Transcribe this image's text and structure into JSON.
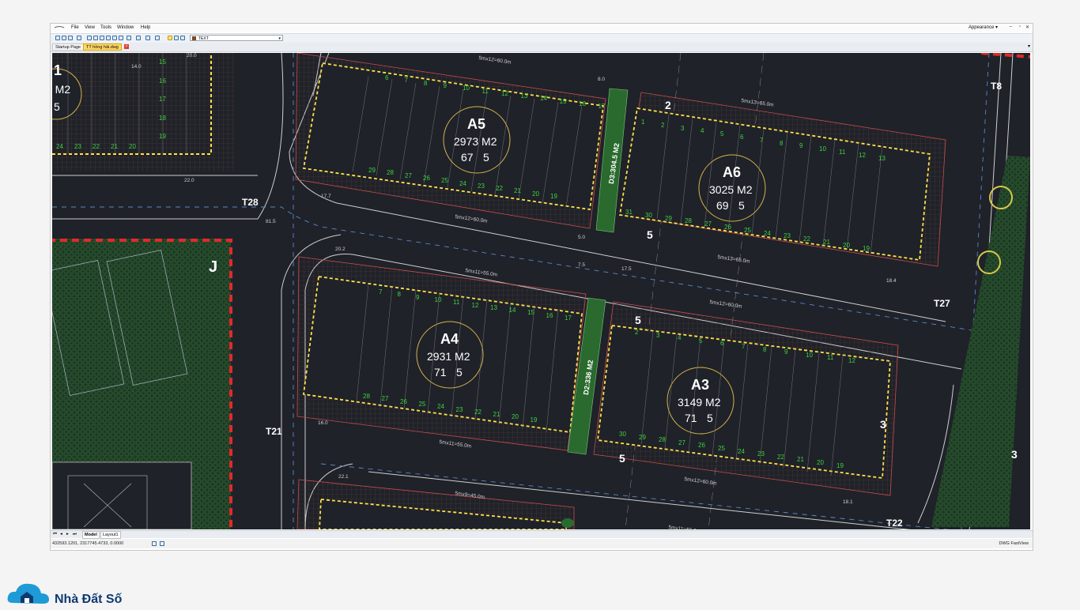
{
  "menubar": {
    "file": "File",
    "view": "View",
    "tools": "Tools",
    "window": "Window",
    "help": "Help",
    "appearance": "Appearance ▾"
  },
  "toolbar": {
    "layer_combo_value": "TEXT"
  },
  "tabs": {
    "startup": "Startup Page",
    "drawing": "TT hồng hải.dwg"
  },
  "bottom_tabs": {
    "model": "Model",
    "layout": "Layout1"
  },
  "status": {
    "coords": "432593.1201, 2317745.4733, 0.0000",
    "brand": "DWG FastView"
  },
  "watermark": {
    "text": "Nhà Đất Số"
  },
  "drawing": {
    "blocks": {
      "a5": {
        "name": "A5",
        "area": "2973 M2",
        "count": "67",
        "floors": "5"
      },
      "a6": {
        "name": "A6",
        "area": "3025 M2",
        "count": "69",
        "floors": "5"
      },
      "a4": {
        "name": "A4",
        "area": "2931 M2",
        "count": "71",
        "floors": "5"
      },
      "a3": {
        "name": "A3",
        "area": "3149 M2",
        "count": "71",
        "floors": "5"
      },
      "left": {
        "area": "5 M2",
        "floors": "5"
      }
    },
    "medians": {
      "d3": "D3:304.5 M2",
      "d2": "D2:336 M2"
    },
    "dims": {
      "a5_top": "5mx12=60.0m",
      "a5_bottom": "5mx12=60.0m",
      "a6_top": "5mx13=65.0m",
      "a6_bottom": "5mx13=65.0m",
      "a4_top": "5mx11=55.0m",
      "a4_bottom": "5mx11=55.0m",
      "a3_top": "5mx12=60.0m",
      "a3_bottom": "5mx12=60.0m",
      "bot_top": "5mx9=45.0m",
      "bot_bottom": "5mx11=55.0m"
    },
    "road_labels": {
      "t28": "T28",
      "t21": "T21",
      "t8": "T8",
      "t27": "T27",
      "t22": "T22",
      "j": "J",
      "lbl_1": "1"
    },
    "sections": {
      "s2": "2",
      "s5a": "5",
      "s5b": "5",
      "s5c": "5",
      "s3a": "3",
      "s3b": "3"
    },
    "measures": {
      "m20_0": "20.0",
      "m22_0": "22.0",
      "m17_7": "17.7",
      "m20_2": "20.2",
      "m18_4": "18.4",
      "m16_0": "16.0",
      "m18_1": "18.1",
      "m22_1": "22.1",
      "m8_0": "8.0",
      "m5_0": "5.0",
      "m7_5": "7.5",
      "m17_5": "17.5",
      "m14_0": "14.0",
      "m81_5": "81.5"
    },
    "lot_numbers": {
      "a5_top": [
        "6",
        "7",
        "8",
        "9",
        "10",
        "11",
        "12",
        "13",
        "14",
        "15",
        "16",
        "17"
      ],
      "a5_bottom": [
        "29",
        "28",
        "27",
        "26",
        "25",
        "24",
        "23",
        "22",
        "21",
        "20",
        "19"
      ],
      "a6_top": [
        "1",
        "2",
        "3",
        "4",
        "5",
        "6",
        "7",
        "8",
        "9",
        "10",
        "11",
        "12",
        "13"
      ],
      "a6_bottom": [
        "31",
        "30",
        "29",
        "28",
        "27",
        "26",
        "25",
        "24",
        "23",
        "22",
        "21",
        "20",
        "19"
      ],
      "a4_top": [
        "7",
        "8",
        "9",
        "10",
        "11",
        "12",
        "13",
        "14",
        "15",
        "16",
        "17"
      ],
      "a4_bottom": [
        "28",
        "27",
        "26",
        "25",
        "24",
        "23",
        "22",
        "21",
        "20",
        "19"
      ],
      "a3_top": [
        "2",
        "3",
        "4",
        "5",
        "6",
        "7",
        "8",
        "9",
        "10",
        "11",
        "12"
      ],
      "a3_bottom": [
        "30",
        "29",
        "28",
        "27",
        "26",
        "25",
        "24",
        "23",
        "22",
        "21",
        "20",
        "19"
      ],
      "left_col": [
        "15",
        "16",
        "17",
        "18",
        "19"
      ],
      "left_bottom": [
        "24",
        "23",
        "22",
        "21",
        "20"
      ]
    }
  }
}
